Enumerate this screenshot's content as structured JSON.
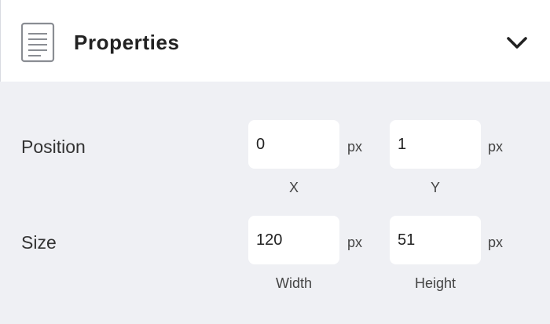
{
  "header": {
    "icon": "document-icon",
    "title": "Properties",
    "toggle_icon": "chevron-down-icon"
  },
  "position": {
    "label": "Position",
    "x": {
      "value": "0",
      "unit": "px",
      "caption": "X"
    },
    "y": {
      "value": "1",
      "unit": "px",
      "caption": "Y"
    }
  },
  "size": {
    "label": "Size",
    "width": {
      "value": "120",
      "unit": "px",
      "caption": "Width"
    },
    "height": {
      "value": "51",
      "unit": "px",
      "caption": "Height"
    }
  },
  "colors": {
    "header_bg": "#ffffff",
    "panel_bg": "#eff0f4",
    "field_bg": "#ffffff"
  }
}
